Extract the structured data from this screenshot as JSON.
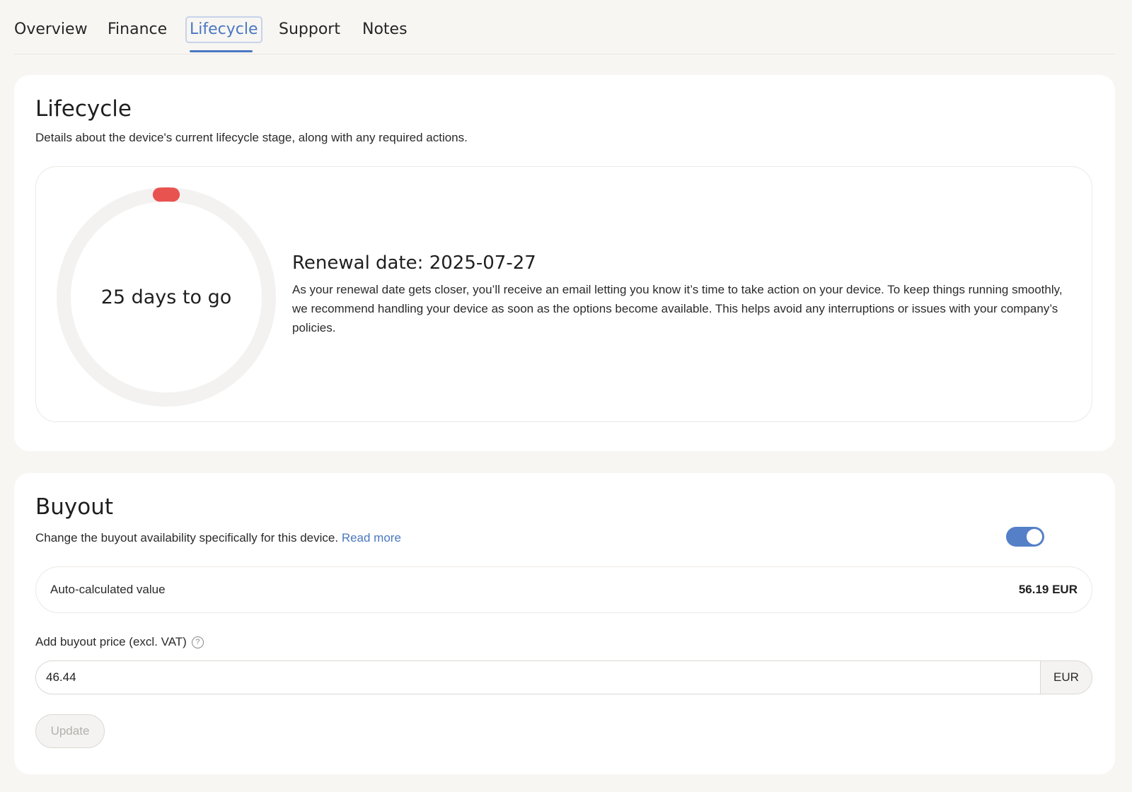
{
  "tabs": [
    {
      "label": "Overview"
    },
    {
      "label": "Finance"
    },
    {
      "label": "Lifecycle"
    },
    {
      "label": "Support"
    },
    {
      "label": "Notes"
    }
  ],
  "active_tab": "Lifecycle",
  "lifecycle": {
    "title": "Lifecycle",
    "subtitle": "Details about the device's current lifecycle stage, along with any required actions.",
    "countdown": "25 days to go",
    "progress_fraction": 0.02,
    "renewal_title": "Renewal date: 2025-07-27",
    "renewal_text": "As your renewal date gets closer, you’ll receive an email letting you know it’s time to take action on your device. To keep things running smoothly, we recommend handling your device as soon as the options become available. This helps avoid any interruptions or issues with your company’s policies."
  },
  "buyout": {
    "title": "Buyout",
    "subtitle": "Change the buyout availability specifically for this device.",
    "read_more": "Read more",
    "toggle_on": true,
    "auto_label": "Auto-calculated value",
    "auto_value": "56.19 EUR",
    "price_label": "Add buyout price (excl. VAT)",
    "price_value": "46.44",
    "price_unit": "EUR",
    "update_label": "Update"
  },
  "colors": {
    "accent": "#4a78c2",
    "toggle": "#5580c8",
    "ring_track": "#f3f2f1",
    "ring_progress": "#e8534f",
    "page_bg": "#f8f6f3"
  },
  "icons": {
    "help": "question-circle-icon"
  }
}
